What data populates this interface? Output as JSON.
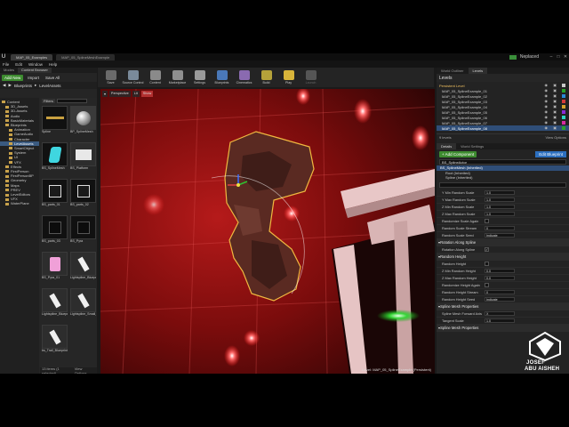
{
  "window": {
    "tabs": [
      "MAP_05_Examples",
      "MAP_05_SplineMeshExample"
    ],
    "project": "Neplaced"
  },
  "menu": [
    "File",
    "Edit",
    "Window",
    "Help"
  ],
  "content_browser": {
    "tabs": [
      "Modes",
      "Content Browser"
    ],
    "add_new": "Add New",
    "import": "Import",
    "save_all": "Save All",
    "breadcrumb": [
      "Blueprints",
      "LevelAssets"
    ],
    "tree": [
      "Content",
      "3D_Assets",
      "3D-Assets",
      "Audio",
      "BasicMaterials",
      "Blueprints",
      "Animation",
      "GameAudio",
      "Character",
      "LevelAssets",
      "SmartObject",
      "System",
      "UI",
      "VFX",
      "Effects",
      "FirstPerson",
      "FirstPersonBP",
      "Geometry",
      "Maps",
      "PREV",
      "LevelEditors",
      "VFX",
      "WaterPlane"
    ],
    "filters": "Filters",
    "assets": [
      {
        "label": "Spline",
        "thumb": "black"
      },
      {
        "label": "BP_SplineMesh",
        "thumb": "sphere"
      },
      {
        "label": "BS_SplineMesh",
        "thumb": "cyan"
      },
      {
        "label": "BS_Platform",
        "thumb": "white-box"
      },
      {
        "label": "BS_parts_01",
        "thumb": "box"
      },
      {
        "label": "BS_parts_02",
        "thumb": "box"
      },
      {
        "label": "BS_parts_03",
        "thumb": "dark"
      },
      {
        "label": "BS_Pyra",
        "thumb": "dark"
      },
      {
        "label": "BS_Pyra_01",
        "thumb": "pink"
      },
      {
        "label": "Lightspline_Blueprint",
        "thumb": "white"
      },
      {
        "label": "Lightspline_Blueprint",
        "thumb": "white"
      },
      {
        "label": "Lightspline_Small_Blueprint",
        "thumb": "white"
      },
      {
        "label": "bs_Trail_Blueprint",
        "thumb": "white"
      }
    ],
    "footer_count": "13 items (1 selected)",
    "view_options": "View Options"
  },
  "toolbar": [
    {
      "label": "Save",
      "color": "#6b6b6b"
    },
    {
      "label": "Source Control",
      "color": "#7a8a9a"
    },
    {
      "label": "Content",
      "color": "#8a8a8a"
    },
    {
      "label": "Marketplace",
      "color": "#8f8f8f"
    },
    {
      "label": "Settings",
      "color": "#9a9a9a"
    },
    {
      "label": "Blueprints",
      "color": "#4a78b8"
    },
    {
      "label": "Cinematics",
      "color": "#8a6ab0"
    },
    {
      "label": "Build",
      "color": "#b5a23a"
    },
    {
      "label": "Play",
      "color": "#d8b43a"
    },
    {
      "label": "Launch",
      "color": "#555555",
      "disabled": true
    }
  ],
  "viewport": {
    "buttons": [
      "Perspective",
      "Lit",
      "Show"
    ],
    "level_label": "Level:  MAP_05_SplineExample (Persistent)"
  },
  "right_panel": {
    "tabs": [
      "World Outliner",
      "Levels"
    ],
    "levels_title": "Levels",
    "levels": [
      {
        "name": "Persistent Level",
        "persistent": true,
        "color": "#c8c8c8"
      },
      {
        "name": "MAP_05_SplineExample_01",
        "color": "#29a329"
      },
      {
        "name": "MAP_05_SplineExample_02",
        "color": "#2b8ad6"
      },
      {
        "name": "MAP_05_SplineExample_03",
        "color": "#d63a3a"
      },
      {
        "name": "MAP_05_SplineExample_04",
        "color": "#d6a32b"
      },
      {
        "name": "MAP_05_SplineExample_05",
        "color": "#8a2bd6"
      },
      {
        "name": "MAP_05_SplineExample_06",
        "color": "#2bd6c0"
      },
      {
        "name": "MAP_05_SplineExample_07",
        "color": "#d62ba0"
      },
      {
        "name": "MAP_05_SplineExample_08",
        "color": "#29a329",
        "selected": true
      }
    ],
    "levels_count": "9 levels",
    "view_options": "View Options",
    "details_tabs": [
      "Details",
      "World Settings"
    ],
    "add_component": "+ Add Component",
    "edit_blueprint": "Edit Blueprint",
    "actor_name": "BS_SplineActor",
    "components": [
      {
        "label": "BS_SplineMesh (Inherited)",
        "root": true
      },
      {
        "label": "Root (Inherited)",
        "child": true
      },
      {
        "label": "Spline (Inherited)",
        "child": true
      }
    ],
    "props": [
      {
        "label": "Y Min Random Scale",
        "value": "1.0"
      },
      {
        "label": "Y Max Random Scale",
        "value": "1.0"
      },
      {
        "label": "Z Min Random Scale",
        "value": "1.0"
      },
      {
        "label": "Z Max Random Scale",
        "value": "1.0"
      },
      {
        "label": "Randomize Scale Again",
        "check": false
      },
      {
        "label": "Random Scale Stream",
        "value": "0"
      },
      {
        "label": "Random Scale Seed",
        "value": "Indicate"
      }
    ],
    "section_rotation": "Rotation Along Spline",
    "rotation_props": [
      {
        "label": "Rotation Along Spline",
        "check": true
      }
    ],
    "section_height": "Random Height",
    "height_props": [
      {
        "label": "Random Height",
        "check": false
      },
      {
        "label": "Z Min Random Height",
        "value": "0.0"
      },
      {
        "label": "Z Max Random Height",
        "value": "0.0"
      },
      {
        "label": "Randomize Height Again",
        "check": false
      },
      {
        "label": "Random Height Stream",
        "value": "0"
      },
      {
        "label": "Random Height Seed",
        "value": "Indicate"
      }
    ],
    "section_spline": "Spline Mesh Properties",
    "spline_props": [
      {
        "label": "Spline Mesh Forward Axis",
        "value": "X"
      },
      {
        "label": "Tangent Scale",
        "value": "1.0"
      }
    ],
    "section_more": "Spline Mesh Properties"
  },
  "watermark": {
    "line1": "JOSEF",
    "line2": "ABU AISHEH"
  }
}
